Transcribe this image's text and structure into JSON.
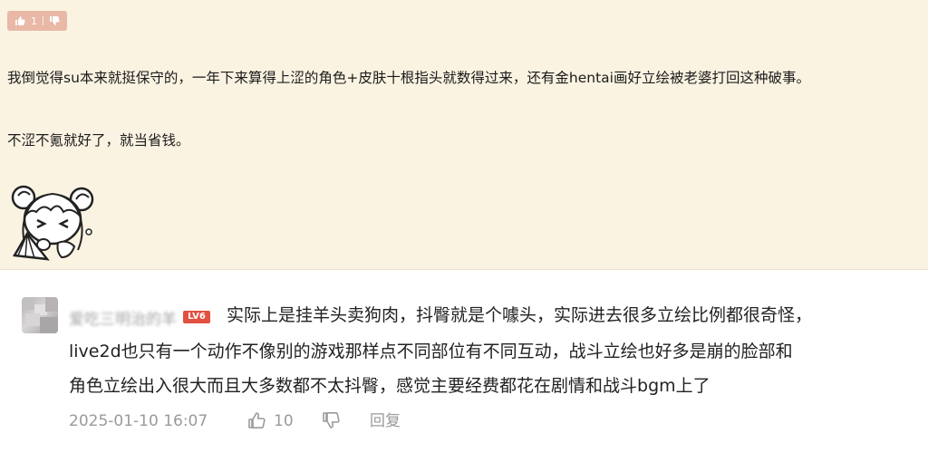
{
  "top_comment": {
    "like_count": "1",
    "paragraphs": [
      "我倒觉得su本来就挺保守的，一年下来算得上涩的角色+皮肤十根指头就数得过来，还有金hentai画好立绘被老婆打回这种破事。",
      "不涩不氪就好了，就当省钱。"
    ],
    "sticker_icon": "chibi-girl-sticker"
  },
  "reply": {
    "username": "爱吃三明治的羊",
    "level_badge": "LV6",
    "text_lines": [
      "实际上是挂羊头卖狗肉，抖臀就是个噱头，实际进去很多立绘比例都很奇怪，",
      "live2d也只有一个动作不像别的游戏那样点不同部位有不同互动，战斗立绘也好多是崩的脸部和",
      "角色立绘出入很大而且大多数都不太抖臀，感觉主要经费都花在剧情和战斗bgm上了"
    ],
    "timestamp": "2025-01-10 16:07",
    "like_count": "10",
    "reply_label": "回复"
  },
  "colors": {
    "top_background": "#fbf3e2",
    "vote_pill": "#e9b8a6",
    "level_badge": "#e2503f",
    "meta_text": "#9a9a9a"
  }
}
